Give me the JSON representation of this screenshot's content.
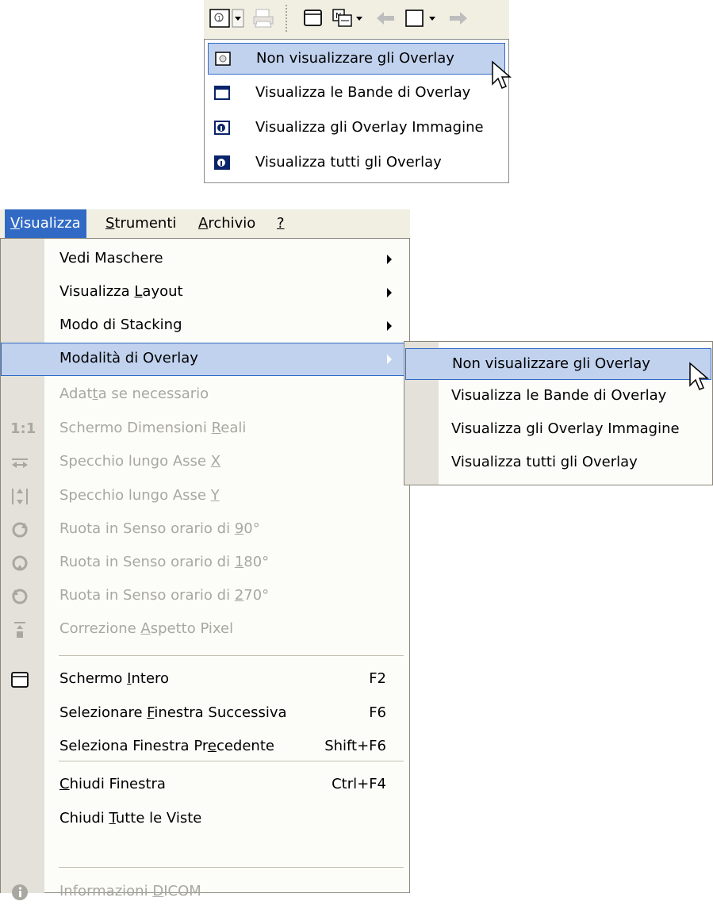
{
  "toolbar_dropdown": {
    "items": [
      {
        "label": "Non visualizzare gli Overlay",
        "icon": "overlay-none-icon",
        "highlighted": true
      },
      {
        "label": "Visualizza le Bande di Overlay",
        "icon": "overlay-bands-icon"
      },
      {
        "label": "Visualizza gli Overlay Immagine",
        "icon": "overlay-image-icon"
      },
      {
        "label": "Visualizza tutti gli Overlay",
        "icon": "overlay-all-icon"
      }
    ]
  },
  "menubar": {
    "items": [
      {
        "label": "Visualizza",
        "mnemonic": "V",
        "active": true
      },
      {
        "label": "Strumenti",
        "mnemonic": "S"
      },
      {
        "label": "Archivio",
        "mnemonic": "A"
      },
      {
        "label": "?",
        "mnemonic": "?"
      }
    ]
  },
  "view_menu": {
    "items": [
      {
        "pre": "Vedi Maschere",
        "u": "",
        "post": "",
        "submenu": true
      },
      {
        "pre": "Visualizza ",
        "u": "L",
        "post": "ayout",
        "submenu": true
      },
      {
        "pre": "Modo di Stacking",
        "u": "",
        "post": "",
        "submenu": true
      },
      {
        "pre": "Modalità di Overlay",
        "u": "",
        "post": "",
        "submenu": true,
        "highlighted": true
      },
      {
        "pre": "Adat",
        "u": "t",
        "post": "a se necessario",
        "disabled": true
      },
      {
        "pre": "Schermo Dimensioni ",
        "u": "R",
        "post": "eali",
        "disabled": true,
        "icon_text": "1:1"
      },
      {
        "pre": "Specchio lungo Asse ",
        "u": "X",
        "post": "",
        "disabled": true,
        "icon": "mirror-x-icon"
      },
      {
        "pre": "Specchio lungo Asse ",
        "u": "Y",
        "post": "",
        "disabled": true,
        "icon": "mirror-y-icon"
      },
      {
        "pre": "Ruota in Senso orario di ",
        "u": "9",
        "post": "0°",
        "disabled": true,
        "icon": "rotate-90-icon"
      },
      {
        "pre": "Ruota in Senso orario di ",
        "u": "1",
        "post": "80°",
        "disabled": true,
        "icon": "rotate-180-icon"
      },
      {
        "pre": "Ruota in Senso orario di ",
        "u": "2",
        "post": "70°",
        "disabled": true,
        "icon": "rotate-270-icon"
      },
      {
        "pre": "Correzione ",
        "u": "A",
        "post": "spetto Pixel",
        "disabled": true,
        "icon": "pixel-aspect-icon"
      },
      {
        "pre": "Schermo ",
        "u": "I",
        "post": "ntero",
        "shortcut": "F2",
        "icon": "fullscreen-icon"
      },
      {
        "pre": "Selezionare ",
        "u": "F",
        "post": "inestra Successiva",
        "shortcut": "F6"
      },
      {
        "pre": "Seleziona Finestra Pr",
        "u": "e",
        "post": "cedente",
        "shortcut": "Shift+F6"
      },
      {
        "pre": "",
        "u": "C",
        "post": "hiudi Finestra",
        "shortcut": "Ctrl+F4"
      },
      {
        "pre": "Chiudi ",
        "u": "T",
        "post": "utte le Viste"
      },
      {
        "pre": "Informazioni ",
        "u": "D",
        "post": "ICOM",
        "disabled": true,
        "icon": "info-icon"
      }
    ]
  },
  "overlay_submenu": {
    "items": [
      {
        "label": "Non visualizzare gli Overlay",
        "highlighted": true
      },
      {
        "label": "Visualizza le Bande di Overlay"
      },
      {
        "label": "Visualizza gli Overlay Immagine"
      },
      {
        "label": "Visualizza tutti gli Overlay"
      }
    ]
  }
}
